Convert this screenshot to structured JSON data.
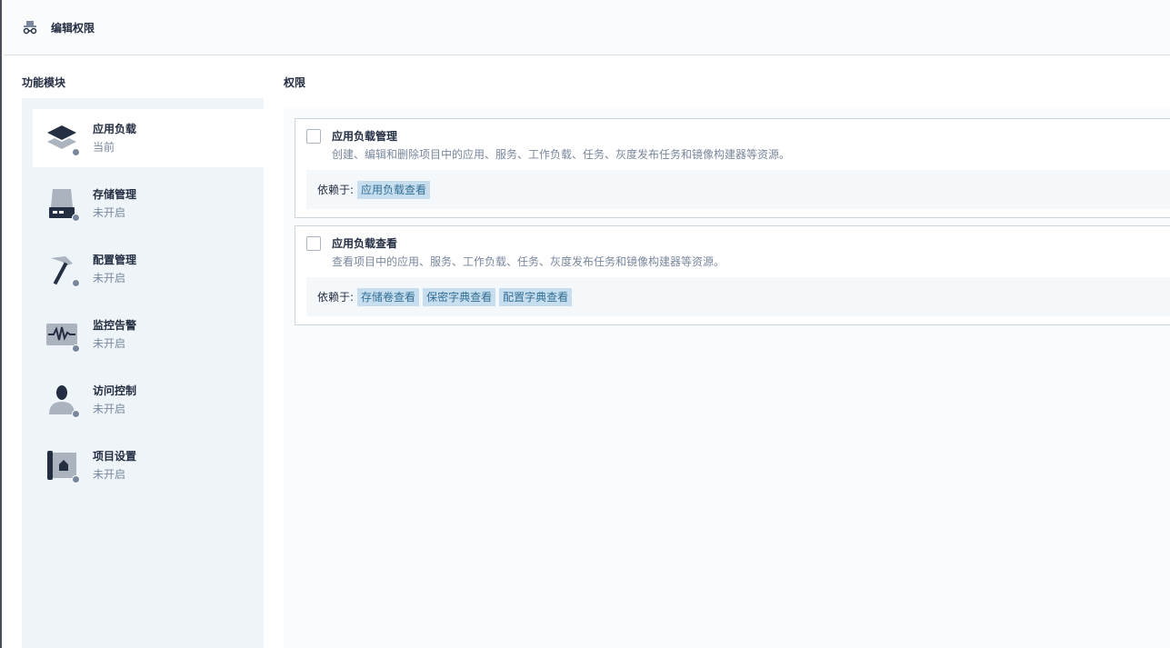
{
  "header": {
    "title": "编辑权限",
    "icon": "incognito-icon"
  },
  "modules": {
    "title": "功能模块",
    "items": [
      {
        "name": "应用负载",
        "status": "当前",
        "icon": "layers-icon",
        "active": true
      },
      {
        "name": "存储管理",
        "status": "未开启",
        "icon": "storage-icon",
        "active": false
      },
      {
        "name": "配置管理",
        "status": "未开启",
        "icon": "hammer-icon",
        "active": false
      },
      {
        "name": "监控告警",
        "status": "未开启",
        "icon": "monitor-icon",
        "active": false
      },
      {
        "name": "访问控制",
        "status": "未开启",
        "icon": "user-icon",
        "active": false
      },
      {
        "name": "项目设置",
        "status": "未开启",
        "icon": "project-icon",
        "active": false
      }
    ]
  },
  "permissions": {
    "title": "权限",
    "items": [
      {
        "name": "应用负载管理",
        "description": "创建、编辑和删除项目中的应用、服务、工作负载、任务、灰度发布任务和镜像构建器等资源。",
        "depends_label": "依赖于:",
        "depends": [
          "应用负载查看"
        ]
      },
      {
        "name": "应用负载查看",
        "description": "查看项目中的应用、服务、工作负载、任务、灰度发布任务和镜像构建器等资源。",
        "depends_label": "依赖于:",
        "depends": [
          "存储卷查看",
          "保密字典查看",
          "配置字典查看"
        ]
      }
    ]
  },
  "colors": {
    "tag_bg": "#c7deef",
    "tag_text": "#326e93",
    "panel_bg": "#eff4f9",
    "text_primary": "#242e42",
    "text_secondary": "#79879c"
  }
}
